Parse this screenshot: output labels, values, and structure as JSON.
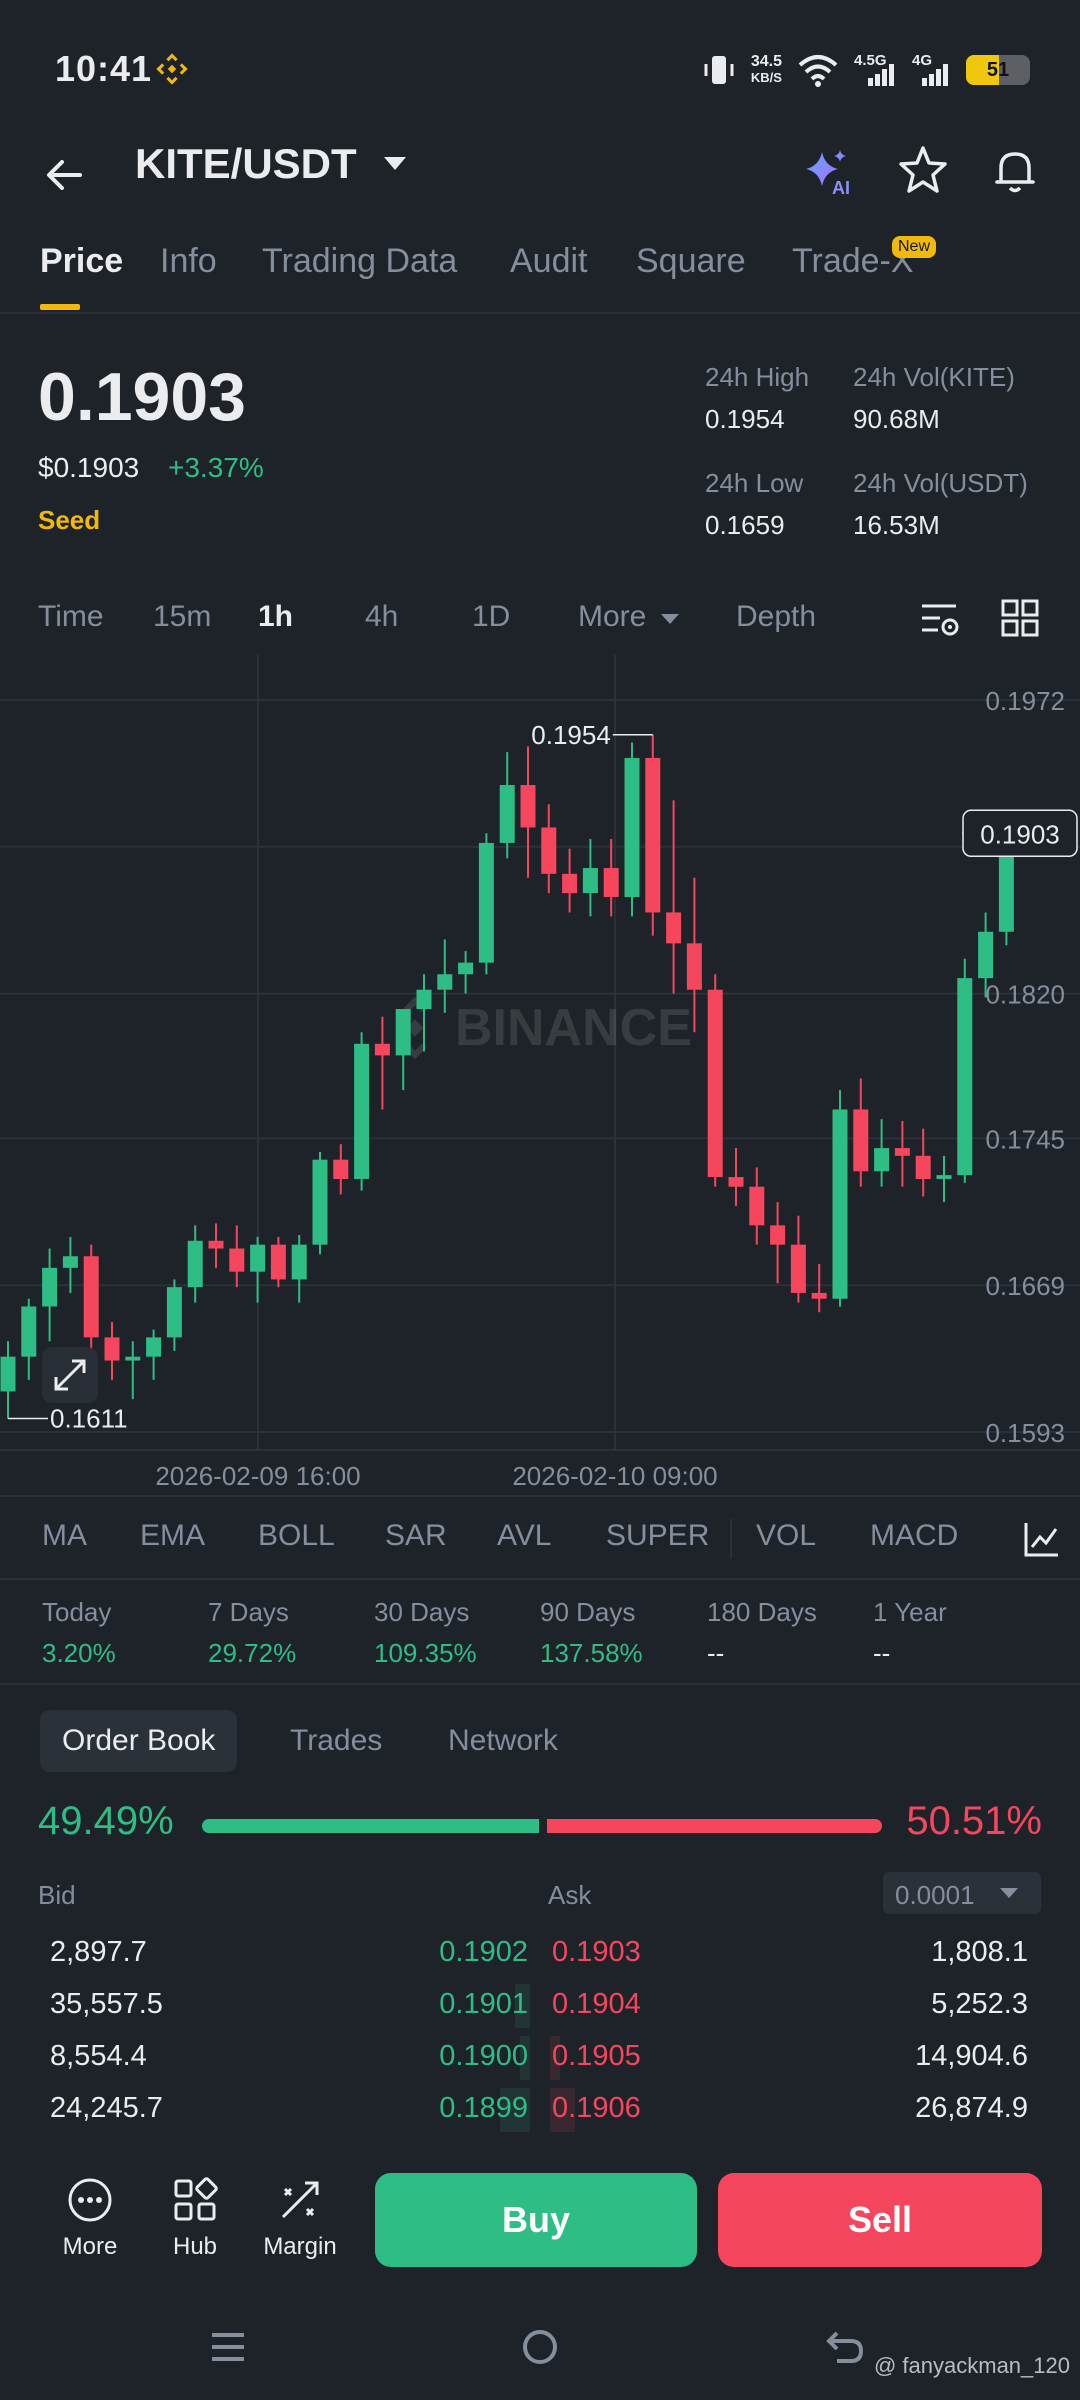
{
  "status_bar": {
    "time": "10:41",
    "net_speed_top": "34.5",
    "net_speed_bottom": "KB/S",
    "net_type_1": "4.5G",
    "net_type_2": "4G",
    "battery": "51",
    "battery_level": 0.51
  },
  "header": {
    "pair": "KITE/USDT",
    "ai_badge": "AI"
  },
  "tabs": [
    "Price",
    "Info",
    "Trading Data",
    "Audit",
    "Square",
    "Trade-X"
  ],
  "tabs_new_badge": "New",
  "price": {
    "last": "0.1903",
    "fiat": "$0.1903",
    "change": "+3.37%",
    "tag": "Seed",
    "high_label": "24h High",
    "high": "0.1954",
    "low_label": "24h Low",
    "low": "0.1659",
    "vol_base_label": "24h Vol(KITE)",
    "vol_base": "90.68M",
    "vol_quote_label": "24h Vol(USDT)",
    "vol_quote": "16.53M"
  },
  "intervals": [
    "Time",
    "15m",
    "1h",
    "4h",
    "1D",
    "More",
    "Depth"
  ],
  "chart_data": {
    "type": "candlestick",
    "watermark": "BINANCE",
    "y_ticks": [
      "0.1972",
      "0.1820",
      "0.1745",
      "0.1669",
      "0.1593"
    ],
    "ylim": [
      0.1593,
      0.1972
    ],
    "x_ticks": [
      "2026-02-09 16:00",
      "2026-02-10 09:00"
    ],
    "current_price_label": "0.1903",
    "max_label": "0.1954",
    "min_label": "0.1611",
    "candles": [
      {
        "o": 0.1614,
        "h": 0.164,
        "l": 0.16,
        "c": 0.1632
      },
      {
        "o": 0.1632,
        "h": 0.1662,
        "l": 0.162,
        "c": 0.1658
      },
      {
        "o": 0.1658,
        "h": 0.1688,
        "l": 0.164,
        "c": 0.1678
      },
      {
        "o": 0.1678,
        "h": 0.1694,
        "l": 0.1665,
        "c": 0.1684
      },
      {
        "o": 0.1684,
        "h": 0.169,
        "l": 0.1636,
        "c": 0.1642
      },
      {
        "o": 0.1642,
        "h": 0.165,
        "l": 0.162,
        "c": 0.163
      },
      {
        "o": 0.163,
        "h": 0.164,
        "l": 0.161,
        "c": 0.1632
      },
      {
        "o": 0.1632,
        "h": 0.1646,
        "l": 0.162,
        "c": 0.1642
      },
      {
        "o": 0.1642,
        "h": 0.1672,
        "l": 0.1635,
        "c": 0.1668
      },
      {
        "o": 0.1668,
        "h": 0.17,
        "l": 0.166,
        "c": 0.1692
      },
      {
        "o": 0.1692,
        "h": 0.1701,
        "l": 0.1678,
        "c": 0.1688
      },
      {
        "o": 0.1688,
        "h": 0.17,
        "l": 0.1668,
        "c": 0.1676
      },
      {
        "o": 0.1676,
        "h": 0.1694,
        "l": 0.166,
        "c": 0.169
      },
      {
        "o": 0.169,
        "h": 0.1694,
        "l": 0.1668,
        "c": 0.1672
      },
      {
        "o": 0.1672,
        "h": 0.1695,
        "l": 0.166,
        "c": 0.169
      },
      {
        "o": 0.169,
        "h": 0.1738,
        "l": 0.1685,
        "c": 0.1734
      },
      {
        "o": 0.1734,
        "h": 0.1742,
        "l": 0.1716,
        "c": 0.1724
      },
      {
        "o": 0.1724,
        "h": 0.18,
        "l": 0.1718,
        "c": 0.1794
      },
      {
        "o": 0.1794,
        "h": 0.1808,
        "l": 0.176,
        "c": 0.1788
      },
      {
        "o": 0.1788,
        "h": 0.181,
        "l": 0.177,
        "c": 0.1812
      },
      {
        "o": 0.1812,
        "h": 0.183,
        "l": 0.179,
        "c": 0.1822
      },
      {
        "o": 0.1822,
        "h": 0.1848,
        "l": 0.181,
        "c": 0.183
      },
      {
        "o": 0.183,
        "h": 0.1842,
        "l": 0.182,
        "c": 0.1836
      },
      {
        "o": 0.1836,
        "h": 0.1903,
        "l": 0.183,
        "c": 0.1898
      },
      {
        "o": 0.1898,
        "h": 0.1945,
        "l": 0.189,
        "c": 0.1928
      },
      {
        "o": 0.1928,
        "h": 0.1948,
        "l": 0.188,
        "c": 0.1906
      },
      {
        "o": 0.1906,
        "h": 0.1918,
        "l": 0.1872,
        "c": 0.1882
      },
      {
        "o": 0.1882,
        "h": 0.1895,
        "l": 0.1862,
        "c": 0.1872
      },
      {
        "o": 0.1872,
        "h": 0.19,
        "l": 0.186,
        "c": 0.1885
      },
      {
        "o": 0.1885,
        "h": 0.19,
        "l": 0.186,
        "c": 0.187
      },
      {
        "o": 0.187,
        "h": 0.195,
        "l": 0.186,
        "c": 0.1942
      },
      {
        "o": 0.1942,
        "h": 0.1954,
        "l": 0.185,
        "c": 0.1862
      },
      {
        "o": 0.1862,
        "h": 0.192,
        "l": 0.182,
        "c": 0.1846
      },
      {
        "o": 0.1846,
        "h": 0.188,
        "l": 0.18,
        "c": 0.1822
      },
      {
        "o": 0.1822,
        "h": 0.183,
        "l": 0.172,
        "c": 0.1725
      },
      {
        "o": 0.1725,
        "h": 0.174,
        "l": 0.171,
        "c": 0.172
      },
      {
        "o": 0.172,
        "h": 0.173,
        "l": 0.169,
        "c": 0.17
      },
      {
        "o": 0.17,
        "h": 0.1712,
        "l": 0.167,
        "c": 0.169
      },
      {
        "o": 0.169,
        "h": 0.1705,
        "l": 0.166,
        "c": 0.1665
      },
      {
        "o": 0.1665,
        "h": 0.168,
        "l": 0.1655,
        "c": 0.1662
      },
      {
        "o": 0.1662,
        "h": 0.177,
        "l": 0.1658,
        "c": 0.176
      },
      {
        "o": 0.176,
        "h": 0.1776,
        "l": 0.172,
        "c": 0.1728
      },
      {
        "o": 0.1728,
        "h": 0.1755,
        "l": 0.172,
        "c": 0.174
      },
      {
        "o": 0.174,
        "h": 0.1754,
        "l": 0.172,
        "c": 0.1736
      },
      {
        "o": 0.1736,
        "h": 0.175,
        "l": 0.1715,
        "c": 0.1724
      },
      {
        "o": 0.1724,
        "h": 0.1736,
        "l": 0.1712,
        "c": 0.1726
      },
      {
        "o": 0.1726,
        "h": 0.1838,
        "l": 0.1722,
        "c": 0.1828
      },
      {
        "o": 0.1828,
        "h": 0.1862,
        "l": 0.1818,
        "c": 0.1852
      },
      {
        "o": 0.1852,
        "h": 0.191,
        "l": 0.1845,
        "c": 0.19
      }
    ]
  },
  "indicators": [
    "MA",
    "EMA",
    "BOLL",
    "SAR",
    "AVL",
    "SUPER",
    "VOL",
    "MACD"
  ],
  "performance": [
    {
      "label": "Today",
      "value": "3.20%"
    },
    {
      "label": "7 Days",
      "value": "29.72%"
    },
    {
      "label": "30 Days",
      "value": "109.35%"
    },
    {
      "label": "90 Days",
      "value": "137.58%"
    },
    {
      "label": "180 Days",
      "value": "--"
    },
    {
      "label": "1 Year",
      "value": "--"
    }
  ],
  "order_book": {
    "tabs": [
      "Order Book",
      "Trades",
      "Network"
    ],
    "bid_ratio": "49.49%",
    "bid_fraction": 0.4949,
    "ask_ratio": "50.51%",
    "bid_label": "Bid",
    "ask_label": "Ask",
    "precision": "0.0001",
    "rows": [
      {
        "bid_qty": "2,897.7",
        "bid_price": "0.1902",
        "ask_price": "0.1903",
        "ask_qty": "1,808.1"
      },
      {
        "bid_qty": "35,557.5",
        "bid_price": "0.1901",
        "ask_price": "0.1904",
        "ask_qty": "5,252.3"
      },
      {
        "bid_qty": "8,554.4",
        "bid_price": "0.1900",
        "ask_price": "0.1905",
        "ask_qty": "14,904.6"
      },
      {
        "bid_qty": "24,245.7",
        "bid_price": "0.1899",
        "ask_price": "0.1906",
        "ask_qty": "26,874.9"
      }
    ]
  },
  "actions": {
    "more": "More",
    "hub": "Hub",
    "margin": "Margin",
    "buy": "Buy",
    "sell": "Sell"
  },
  "watermark": "@ fanyackman_120",
  "colors": {
    "bg": "#1e2329",
    "green": "#2ebd85",
    "red": "#f6465d",
    "accent": "#f0b90b"
  }
}
